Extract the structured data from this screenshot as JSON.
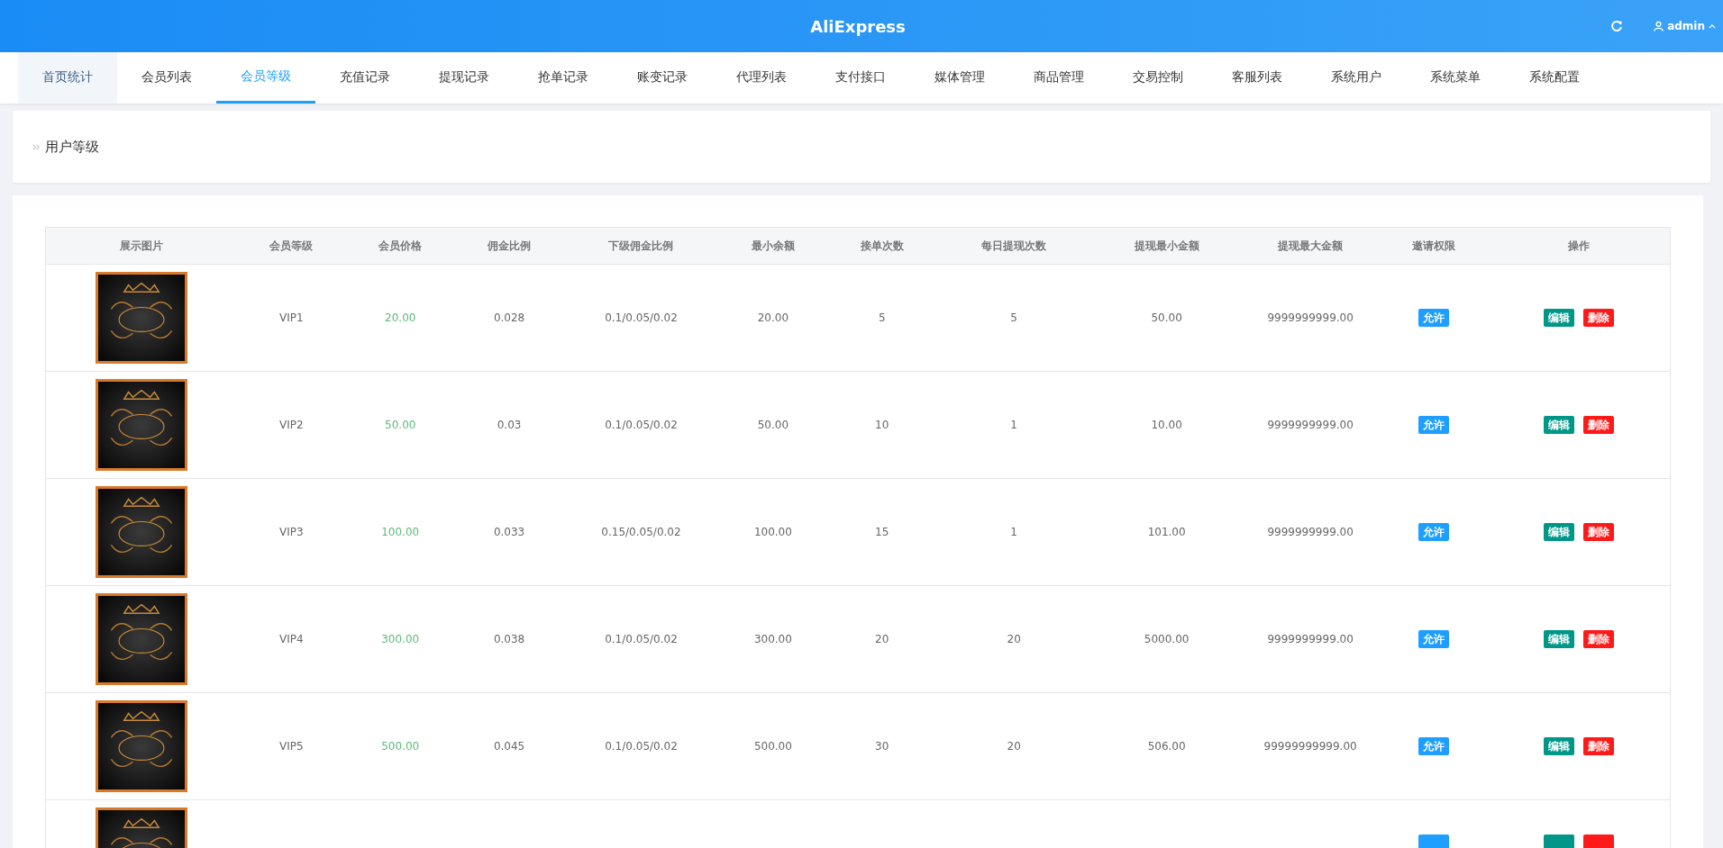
{
  "header": {
    "title": "AliExpress",
    "user": "admin"
  },
  "tabs": [
    {
      "label": "首页统计",
      "selected": false,
      "hovered": true
    },
    {
      "label": "会员列表",
      "selected": false,
      "hovered": false
    },
    {
      "label": "会员等级",
      "selected": true,
      "hovered": false
    },
    {
      "label": "充值记录",
      "selected": false,
      "hovered": false
    },
    {
      "label": "提现记录",
      "selected": false,
      "hovered": false
    },
    {
      "label": "抢单记录",
      "selected": false,
      "hovered": false
    },
    {
      "label": "账变记录",
      "selected": false,
      "hovered": false
    },
    {
      "label": "代理列表",
      "selected": false,
      "hovered": false
    },
    {
      "label": "支付接口",
      "selected": false,
      "hovered": false
    },
    {
      "label": "媒体管理",
      "selected": false,
      "hovered": false
    },
    {
      "label": "商品管理",
      "selected": false,
      "hovered": false
    },
    {
      "label": "交易控制",
      "selected": false,
      "hovered": false
    },
    {
      "label": "客服列表",
      "selected": false,
      "hovered": false
    },
    {
      "label": "系统用户",
      "selected": false,
      "hovered": false
    },
    {
      "label": "系统菜单",
      "selected": false,
      "hovered": false
    },
    {
      "label": "系统配置",
      "selected": false,
      "hovered": false
    }
  ],
  "breadcrumb": "用户等级",
  "table": {
    "columns": [
      "展示图片",
      "会员等级",
      "会员价格",
      "佣金比例",
      "下级佣金比例",
      "最小余额",
      "接单次数",
      "每日提现次数",
      "提现最小金额",
      "提现最大金额",
      "邀请权限",
      "操作"
    ],
    "rows": [
      {
        "kind": "full",
        "level": "VIP1",
        "price": "20.00",
        "ratio": "0.028",
        "sub_ratio": "0.1/0.05/0.02",
        "min_balance": "20.00",
        "orders": "5",
        "daily_withdrawals": "5",
        "min_withdraw": "50.00",
        "max_withdraw": "9999999999.00",
        "invite": "允许",
        "edit": "编辑",
        "delete": "删除"
      },
      {
        "kind": "full",
        "level": "VIP2",
        "price": "50.00",
        "ratio": "0.03",
        "sub_ratio": "0.1/0.05/0.02",
        "min_balance": "50.00",
        "orders": "10",
        "daily_withdrawals": "1",
        "min_withdraw": "10.00",
        "max_withdraw": "9999999999.00",
        "invite": "允许",
        "edit": "编辑",
        "delete": "删除"
      },
      {
        "kind": "full",
        "level": "VIP3",
        "price": "100.00",
        "ratio": "0.033",
        "sub_ratio": "0.15/0.05/0.02",
        "min_balance": "100.00",
        "orders": "15",
        "daily_withdrawals": "1",
        "min_withdraw": "101.00",
        "max_withdraw": "9999999999.00",
        "invite": "允许",
        "edit": "编辑",
        "delete": "删除"
      },
      {
        "kind": "full",
        "level": "VIP4",
        "price": "300.00",
        "ratio": "0.038",
        "sub_ratio": "0.1/0.05/0.02",
        "min_balance": "300.00",
        "orders": "20",
        "daily_withdrawals": "20",
        "min_withdraw": "5000.00",
        "max_withdraw": "9999999999.00",
        "invite": "允许",
        "edit": "编辑",
        "delete": "删除"
      },
      {
        "kind": "full",
        "level": "VIP5",
        "price": "500.00",
        "ratio": "0.045",
        "sub_ratio": "0.1/0.05/0.02",
        "min_balance": "500.00",
        "orders": "30",
        "daily_withdrawals": "20",
        "min_withdraw": "506.00",
        "max_withdraw": "99999999999.00",
        "invite": "允许",
        "edit": "编辑",
        "delete": "删除"
      },
      {
        "kind": "cut"
      }
    ]
  }
}
